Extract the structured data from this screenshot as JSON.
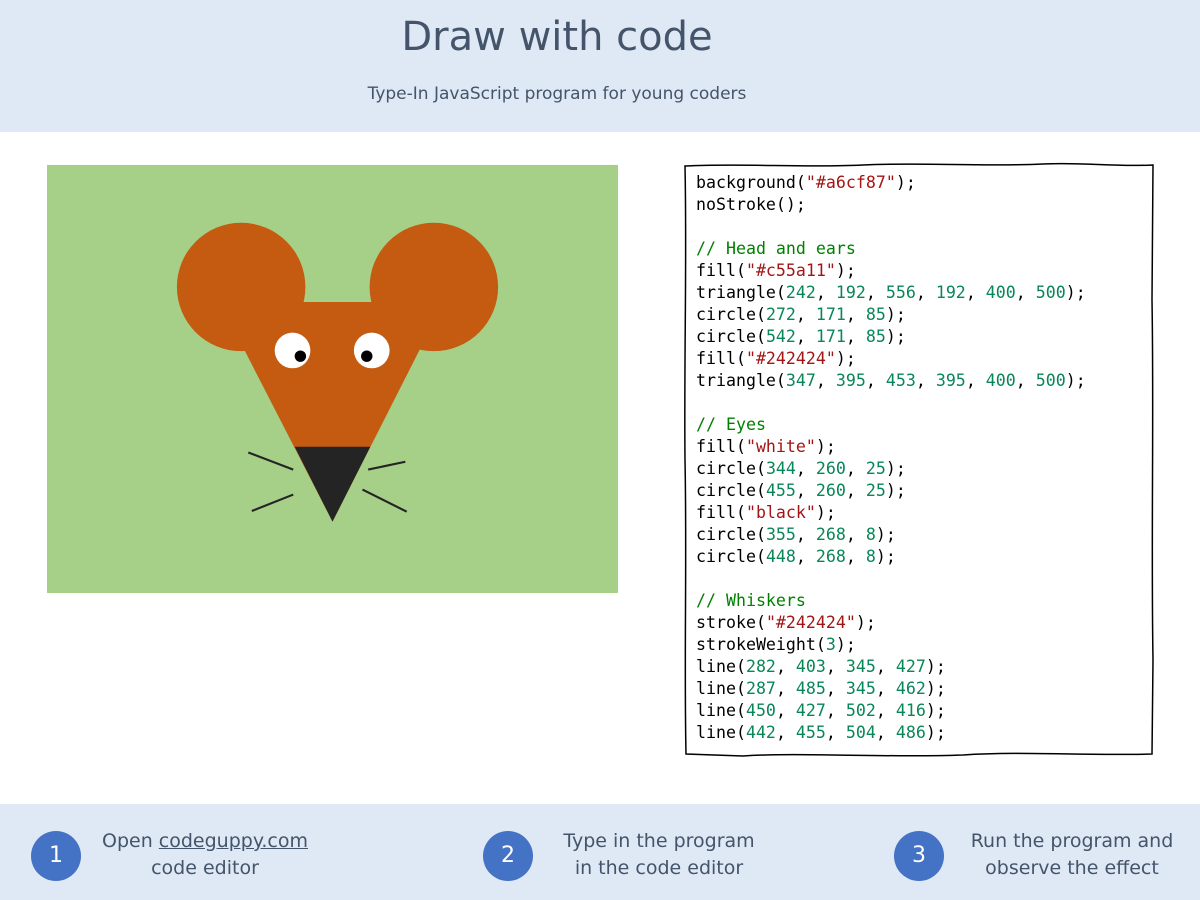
{
  "header": {
    "title": "Draw with code",
    "subtitle": "Type-In JavaScript program for young coders"
  },
  "canvas": {
    "background": "#a6cf87",
    "head_color": "#c55a11",
    "nose_color": "#242424"
  },
  "code_lines": [
    [
      {
        "t": "kw",
        "v": "background("
      },
      {
        "t": "str",
        "v": "\"#a6cf87\""
      },
      {
        "t": "kw",
        "v": ");"
      }
    ],
    [
      {
        "t": "kw",
        "v": "noStroke();"
      }
    ],
    [],
    [
      {
        "t": "cm",
        "v": "// Head and ears"
      }
    ],
    [
      {
        "t": "kw",
        "v": "fill("
      },
      {
        "t": "str",
        "v": "\"#c55a11\""
      },
      {
        "t": "kw",
        "v": ");"
      }
    ],
    [
      {
        "t": "kw",
        "v": "triangle("
      },
      {
        "t": "num",
        "v": "242"
      },
      {
        "t": "kw",
        "v": ", "
      },
      {
        "t": "num",
        "v": "192"
      },
      {
        "t": "kw",
        "v": ", "
      },
      {
        "t": "num",
        "v": "556"
      },
      {
        "t": "kw",
        "v": ", "
      },
      {
        "t": "num",
        "v": "192"
      },
      {
        "t": "kw",
        "v": ", "
      },
      {
        "t": "num",
        "v": "400"
      },
      {
        "t": "kw",
        "v": ", "
      },
      {
        "t": "num",
        "v": "500"
      },
      {
        "t": "kw",
        "v": ");"
      }
    ],
    [
      {
        "t": "kw",
        "v": "circle("
      },
      {
        "t": "num",
        "v": "272"
      },
      {
        "t": "kw",
        "v": ", "
      },
      {
        "t": "num",
        "v": "171"
      },
      {
        "t": "kw",
        "v": ", "
      },
      {
        "t": "num",
        "v": "85"
      },
      {
        "t": "kw",
        "v": ");"
      }
    ],
    [
      {
        "t": "kw",
        "v": "circle("
      },
      {
        "t": "num",
        "v": "542"
      },
      {
        "t": "kw",
        "v": ", "
      },
      {
        "t": "num",
        "v": "171"
      },
      {
        "t": "kw",
        "v": ", "
      },
      {
        "t": "num",
        "v": "85"
      },
      {
        "t": "kw",
        "v": ");"
      }
    ],
    [
      {
        "t": "kw",
        "v": "fill("
      },
      {
        "t": "str",
        "v": "\"#242424\""
      },
      {
        "t": "kw",
        "v": ");"
      }
    ],
    [
      {
        "t": "kw",
        "v": "triangle("
      },
      {
        "t": "num",
        "v": "347"
      },
      {
        "t": "kw",
        "v": ", "
      },
      {
        "t": "num",
        "v": "395"
      },
      {
        "t": "kw",
        "v": ", "
      },
      {
        "t": "num",
        "v": "453"
      },
      {
        "t": "kw",
        "v": ", "
      },
      {
        "t": "num",
        "v": "395"
      },
      {
        "t": "kw",
        "v": ", "
      },
      {
        "t": "num",
        "v": "400"
      },
      {
        "t": "kw",
        "v": ", "
      },
      {
        "t": "num",
        "v": "500"
      },
      {
        "t": "kw",
        "v": ");"
      }
    ],
    [],
    [
      {
        "t": "cm",
        "v": "// Eyes"
      }
    ],
    [
      {
        "t": "kw",
        "v": "fill("
      },
      {
        "t": "str",
        "v": "\"white\""
      },
      {
        "t": "kw",
        "v": ");"
      }
    ],
    [
      {
        "t": "kw",
        "v": "circle("
      },
      {
        "t": "num",
        "v": "344"
      },
      {
        "t": "kw",
        "v": ", "
      },
      {
        "t": "num",
        "v": "260"
      },
      {
        "t": "kw",
        "v": ", "
      },
      {
        "t": "num",
        "v": "25"
      },
      {
        "t": "kw",
        "v": ");"
      }
    ],
    [
      {
        "t": "kw",
        "v": "circle("
      },
      {
        "t": "num",
        "v": "455"
      },
      {
        "t": "kw",
        "v": ", "
      },
      {
        "t": "num",
        "v": "260"
      },
      {
        "t": "kw",
        "v": ", "
      },
      {
        "t": "num",
        "v": "25"
      },
      {
        "t": "kw",
        "v": ");"
      }
    ],
    [
      {
        "t": "kw",
        "v": "fill("
      },
      {
        "t": "str",
        "v": "\"black\""
      },
      {
        "t": "kw",
        "v": ");"
      }
    ],
    [
      {
        "t": "kw",
        "v": "circle("
      },
      {
        "t": "num",
        "v": "355"
      },
      {
        "t": "kw",
        "v": ", "
      },
      {
        "t": "num",
        "v": "268"
      },
      {
        "t": "kw",
        "v": ", "
      },
      {
        "t": "num",
        "v": "8"
      },
      {
        "t": "kw",
        "v": ");"
      }
    ],
    [
      {
        "t": "kw",
        "v": "circle("
      },
      {
        "t": "num",
        "v": "448"
      },
      {
        "t": "kw",
        "v": ", "
      },
      {
        "t": "num",
        "v": "268"
      },
      {
        "t": "kw",
        "v": ", "
      },
      {
        "t": "num",
        "v": "8"
      },
      {
        "t": "kw",
        "v": ");"
      }
    ],
    [],
    [
      {
        "t": "cm",
        "v": "// Whiskers"
      }
    ],
    [
      {
        "t": "kw",
        "v": "stroke("
      },
      {
        "t": "str",
        "v": "\"#242424\""
      },
      {
        "t": "kw",
        "v": ");"
      }
    ],
    [
      {
        "t": "kw",
        "v": "strokeWeight("
      },
      {
        "t": "num",
        "v": "3"
      },
      {
        "t": "kw",
        "v": ");"
      }
    ],
    [
      {
        "t": "kw",
        "v": "line("
      },
      {
        "t": "num",
        "v": "282"
      },
      {
        "t": "kw",
        "v": ", "
      },
      {
        "t": "num",
        "v": "403"
      },
      {
        "t": "kw",
        "v": ", "
      },
      {
        "t": "num",
        "v": "345"
      },
      {
        "t": "kw",
        "v": ", "
      },
      {
        "t": "num",
        "v": "427"
      },
      {
        "t": "kw",
        "v": ");"
      }
    ],
    [
      {
        "t": "kw",
        "v": "line("
      },
      {
        "t": "num",
        "v": "287"
      },
      {
        "t": "kw",
        "v": ", "
      },
      {
        "t": "num",
        "v": "485"
      },
      {
        "t": "kw",
        "v": ", "
      },
      {
        "t": "num",
        "v": "345"
      },
      {
        "t": "kw",
        "v": ", "
      },
      {
        "t": "num",
        "v": "462"
      },
      {
        "t": "kw",
        "v": ");"
      }
    ],
    [
      {
        "t": "kw",
        "v": "line("
      },
      {
        "t": "num",
        "v": "450"
      },
      {
        "t": "kw",
        "v": ", "
      },
      {
        "t": "num",
        "v": "427"
      },
      {
        "t": "kw",
        "v": ", "
      },
      {
        "t": "num",
        "v": "502"
      },
      {
        "t": "kw",
        "v": ", "
      },
      {
        "t": "num",
        "v": "416"
      },
      {
        "t": "kw",
        "v": ");"
      }
    ],
    [
      {
        "t": "kw",
        "v": "line("
      },
      {
        "t": "num",
        "v": "442"
      },
      {
        "t": "kw",
        "v": ", "
      },
      {
        "t": "num",
        "v": "455"
      },
      {
        "t": "kw",
        "v": ", "
      },
      {
        "t": "num",
        "v": "504"
      },
      {
        "t": "kw",
        "v": ", "
      },
      {
        "t": "num",
        "v": "486"
      },
      {
        "t": "kw",
        "v": ");"
      }
    ]
  ],
  "steps": [
    {
      "number": "1",
      "line1_prefix": "Open ",
      "line1_link": "codeguppy.com",
      "line2": "code editor"
    },
    {
      "number": "2",
      "line1": "Type in the program",
      "line2": "in the code editor"
    },
    {
      "number": "3",
      "line1": "Run the program and",
      "line2": "observe the effect"
    }
  ],
  "colors": {
    "band": "#dfe9f5",
    "title_text": "#44546a",
    "step_circle": "#4472c4"
  }
}
